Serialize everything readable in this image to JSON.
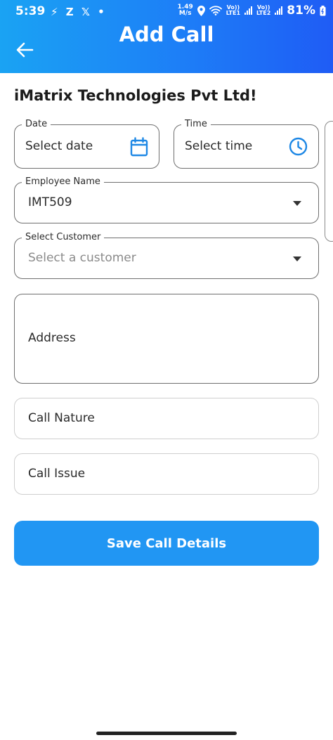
{
  "status_bar": {
    "time": "5:39",
    "left_icons": "⚡ Z 𝕏 •",
    "net_speed_top": "1.49",
    "net_speed_bottom": "M/s",
    "volte1_top": "Vo))",
    "volte1_bottom": "LTE1",
    "volte2_top": "Vo))",
    "volte2_bottom": "LTE2",
    "battery": "81%"
  },
  "header": {
    "title": "Add Call",
    "accent_start": "#1aa3f3",
    "accent_end": "#1f5cf5"
  },
  "company_name": "iMatrix Technologies Pvt Ltd!",
  "form": {
    "date": {
      "label": "Date",
      "placeholder": "Select date",
      "icon": "calendar-icon"
    },
    "time": {
      "label": "Time",
      "placeholder": "Select time",
      "icon": "clock-icon"
    },
    "employee": {
      "label": "Employee Name",
      "value": "IMT509"
    },
    "customer": {
      "label": "Select Customer",
      "placeholder": "Select a customer"
    },
    "address": {
      "placeholder": "Address"
    },
    "call_nature": {
      "placeholder": "Call Nature"
    },
    "call_issue": {
      "placeholder": "Call Issue"
    }
  },
  "save_button": {
    "label": "Save Call Details",
    "color": "#2196f3"
  }
}
